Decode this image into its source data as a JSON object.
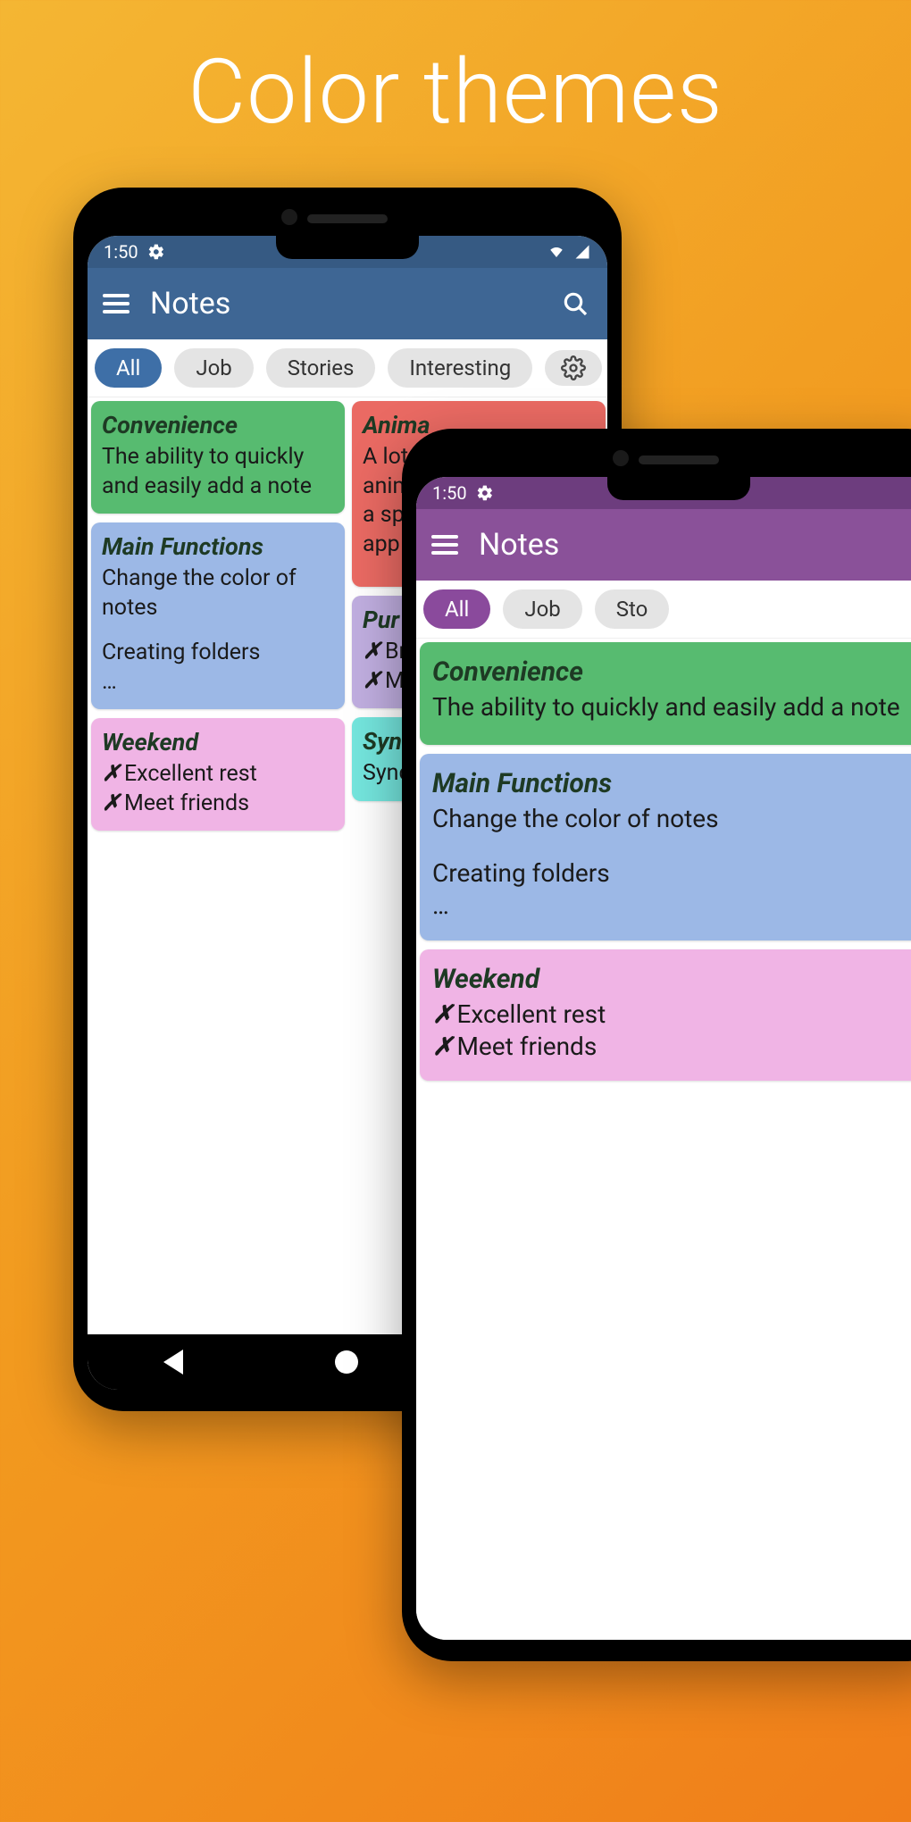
{
  "promo": {
    "title": "Color themes"
  },
  "status": {
    "time": "1:50"
  },
  "appbar": {
    "title": "Notes"
  },
  "chips": {
    "all": "All",
    "job": "Job",
    "stories": "Stories",
    "interesting": "Interesting"
  },
  "chips2": {
    "all": "All",
    "job": "Job",
    "stories_partial": "Sto"
  },
  "notes": {
    "convenience": {
      "title": "Convenience",
      "body": "The ability to quickly and easily add a note"
    },
    "main_functions": {
      "title": "Main Functions",
      "body1": "Change the color of notes",
      "body2": "Creating folders",
      "body3": "…"
    },
    "weekend": {
      "title": "Weekend",
      "item1": "Excellent rest",
      "item2": "Meet friends"
    },
    "animations_partial": {
      "title": "Anima",
      "l1": "A lot",
      "l2": "anim",
      "l3": "a sp",
      "l4": "app"
    },
    "purchases_partial": {
      "title": "Pur",
      "l1": "Br",
      "l2": "M"
    },
    "sync_partial": {
      "title": "Syn",
      "l1": "Sync"
    }
  },
  "check": "✗"
}
